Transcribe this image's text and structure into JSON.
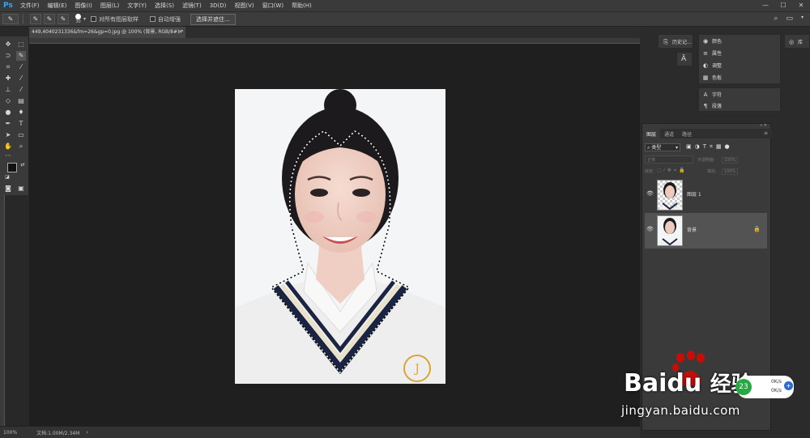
{
  "app": {
    "logo": "Ps"
  },
  "menu": [
    "文件(F)",
    "编辑(E)",
    "图像(I)",
    "图层(L)",
    "文字(Y)",
    "选择(S)",
    "滤镜(T)",
    "3D(D)",
    "视图(V)",
    "窗口(W)",
    "帮助(H)"
  ],
  "window_controls": {
    "minimize": "—",
    "maximize": "☐",
    "close": "✕"
  },
  "options_bar": {
    "brush_size": "30",
    "sample_all_label": "对所有图层取样",
    "auto_enhance_label": "自动增强",
    "select_mask_button": "选择并遮住..."
  },
  "document": {
    "tab_title": "449,4040231336&fm=26&gp=0.jpg @ 100% (背景, RGB/8#) *",
    "close": "×",
    "zoom": "100%",
    "doc_info": "文档:1.00M/2.34M"
  },
  "dock_panels": {
    "history_label": "历史记...",
    "libraries_label": "库",
    "group1": [
      "颜色",
      "属性",
      "调整",
      "色板"
    ],
    "group2": [
      "字符",
      "段落"
    ]
  },
  "layers_panel": {
    "tabs": [
      "图层",
      "通道",
      "路径"
    ],
    "filter_kind": "类型",
    "blend_mode": "正常",
    "opacity_label": "不透明度:",
    "opacity_value": "100%",
    "lock_label": "锁定:",
    "fill_label": "填充:",
    "fill_value": "100%",
    "layers": [
      {
        "name": "图层 1",
        "visible": true,
        "selected": false,
        "locked": false
      },
      {
        "name": "背景",
        "visible": true,
        "selected": true,
        "locked": true
      }
    ]
  },
  "watermark": {
    "brand": "Bai",
    "brand_suffix": "du",
    "brand_cn": "经验",
    "url": "jingyan.baidu.com"
  },
  "network": {
    "up": "0K/s",
    "down": "0K/s",
    "badge": "23"
  },
  "colors": {
    "ps_blue": "#31a8ff",
    "ui_dark": "#282828",
    "canvas_bg": "#1f1f1f",
    "baidu_red": "#e10601",
    "baidu_blue": "#2319dc"
  }
}
